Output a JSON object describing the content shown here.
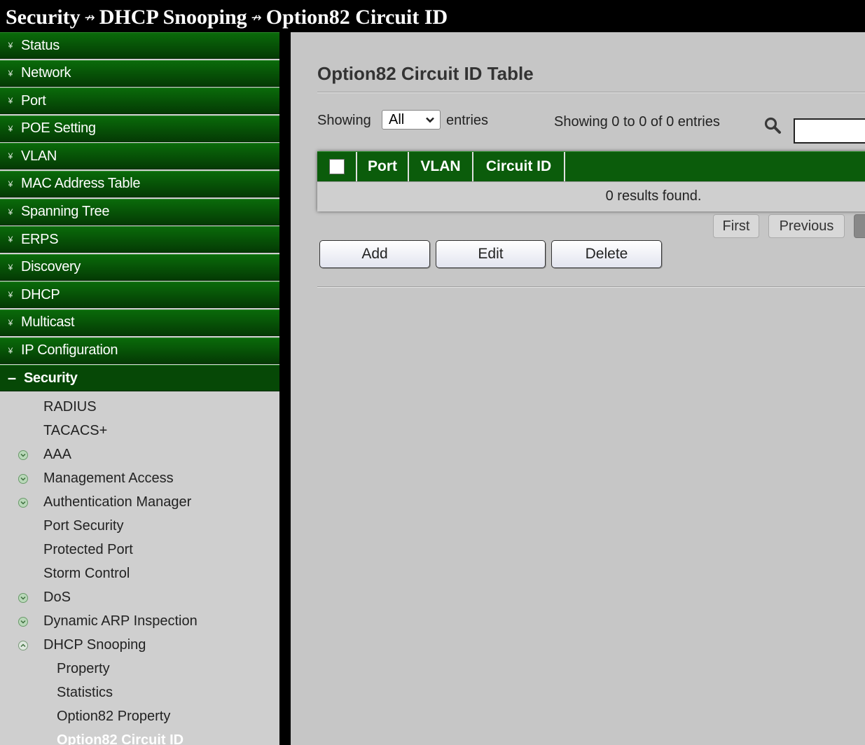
{
  "breadcrumb": {
    "items": [
      "Security",
      "DHCP Snooping",
      "Option82 Circuit ID"
    ],
    "separator": "↛"
  },
  "sidebar": {
    "menu": [
      {
        "label": "Status"
      },
      {
        "label": "Network"
      },
      {
        "label": "Port"
      },
      {
        "label": "POE Setting"
      },
      {
        "label": "VLAN"
      },
      {
        "label": "MAC Address Table"
      },
      {
        "label": "Spanning Tree"
      },
      {
        "label": "ERPS"
      },
      {
        "label": "Discovery"
      },
      {
        "label": "DHCP"
      },
      {
        "label": "Multicast"
      },
      {
        "label": "IP Configuration"
      }
    ],
    "open_section": {
      "label": "Security",
      "icon": "minus"
    },
    "security_items": [
      {
        "label": "RADIUS"
      },
      {
        "label": "TACACS+"
      },
      {
        "label": "AAA"
      },
      {
        "label": "Management Access"
      },
      {
        "label": "Authentication Manager"
      },
      {
        "label": "Port Security"
      },
      {
        "label": "Protected Port"
      },
      {
        "label": "Storm Control"
      },
      {
        "label": "DoS"
      },
      {
        "label": "Dynamic ARP Inspection"
      },
      {
        "label": "DHCP Snooping"
      }
    ],
    "dhcp_snooping_items": [
      {
        "label": "Property"
      },
      {
        "label": "Statistics"
      },
      {
        "label": "Option82 Property"
      },
      {
        "label": "Option82 Circuit ID"
      }
    ]
  },
  "main": {
    "title": "Option82 Circuit ID Table",
    "showing_label": "Showing",
    "entries_select": "All",
    "entries_label": "entries",
    "info": "Showing 0 to 0 of 0 entries",
    "search_placeholder": "",
    "table": {
      "columns": [
        "Port",
        "VLAN",
        "Circuit ID"
      ],
      "empty_message": "0 results found."
    },
    "pager": {
      "first": "First",
      "previous": "Previous"
    },
    "buttons": {
      "add": "Add",
      "edit": "Edit",
      "delete": "Delete"
    }
  },
  "colors": {
    "menu_green": "#075507",
    "table_header_green": "#0b5c0b",
    "content_bg": "#c6c6c6",
    "sidebar_bg": "#cfcfcf"
  }
}
